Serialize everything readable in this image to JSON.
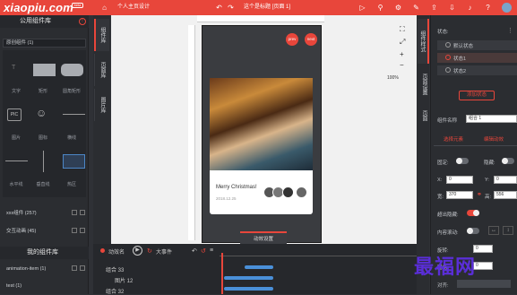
{
  "app": {
    "logo": "xiaopiu.com",
    "badge": "beta",
    "project": "个人主页设计",
    "doc_title": "这个是标题 [页面 1]"
  },
  "left_panel": {
    "title": "公用组件库",
    "category": "原创组件 (1)",
    "items": [
      {
        "label": "文字"
      },
      {
        "label": "矩形"
      },
      {
        "label": "圆角矩形"
      },
      {
        "label": "图片"
      },
      {
        "label": "图标"
      },
      {
        "label": "横线"
      },
      {
        "label": "水平线"
      },
      {
        "label": "垂直线"
      },
      {
        "label": "热区"
      }
    ],
    "list_rows": [
      {
        "label": "xxx组件 (257)"
      },
      {
        "label": "交互动画 (45)"
      }
    ],
    "bottom_title": "我的组件库",
    "bottom_rows": [
      {
        "label": "animation-item (1)"
      },
      {
        "label": "test (1)"
      }
    ]
  },
  "side_tabs_left": [
    {
      "label": "组件库"
    },
    {
      "label": "页面库"
    },
    {
      "label": "图片库"
    }
  ],
  "side_tabs_right": [
    {
      "label": "组件样式"
    },
    {
      "label": "页面设置"
    },
    {
      "label": "页面"
    }
  ],
  "canvas": {
    "buttons": [
      {
        "label": "prev"
      },
      {
        "label": "next"
      }
    ],
    "card": {
      "title": "Merry Christmas!",
      "date": "2018.12.25"
    },
    "zoom": "100%",
    "timeline_toggle": "动效设置"
  },
  "timeline": {
    "tool_labels": [
      "动效名",
      "大事件"
    ],
    "rows": [
      {
        "label": "组合 33"
      },
      {
        "label": "图片 12"
      },
      {
        "label": "组合 32"
      }
    ]
  },
  "right_panel": {
    "state_label": "状态:",
    "states": [
      {
        "label": "默认状态"
      },
      {
        "label": "状态1"
      },
      {
        "label": "状态2"
      }
    ],
    "add_state_button": "添加状态",
    "component_name_label": "组件名称",
    "component_name_value": "组合 1",
    "tabs": [
      "选择元素",
      "编辑动效"
    ],
    "rows": [
      {
        "label": "固定:",
        "label2": "隐藏:"
      },
      {
        "label": "X:",
        "value": "0",
        "label2": "Y:",
        "value2": "0"
      },
      {
        "label": "宽:",
        "value": "370",
        "label2": "高:",
        "value2": "556"
      },
      {
        "label": "超出隐藏:"
      },
      {
        "label": "内容滚动:"
      },
      {
        "label": "旋转:",
        "value": "0"
      },
      {
        "label": "圆角:",
        "value": "0"
      },
      {
        "label": "对齐:"
      }
    ]
  },
  "watermark": "最福网",
  "colors": {
    "accent": "#e8463b",
    "panel": "#2b2d31",
    "topbar": "#e8463b"
  }
}
